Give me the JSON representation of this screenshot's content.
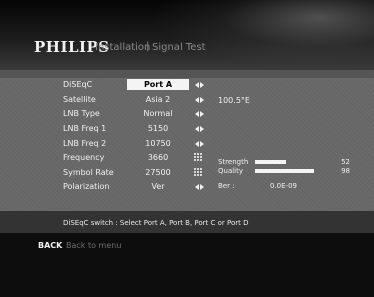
{
  "header": {
    "brand": "PHILIPS",
    "crumb": "Installation",
    "separator": "|",
    "page_title": "Signal Test"
  },
  "settings": [
    {
      "label": "DiSEqC",
      "value": "Port A",
      "control": "arrows",
      "selected": true
    },
    {
      "label": "Satellite",
      "value": "Asia 2",
      "control": "arrows",
      "selected": false
    },
    {
      "label": "LNB Type",
      "value": "Normal",
      "control": "arrows",
      "selected": false
    },
    {
      "label": "LNB Freq 1",
      "value": "5150",
      "control": "arrows",
      "selected": false
    },
    {
      "label": "LNB Freq 2",
      "value": "10750",
      "control": "arrows",
      "selected": false
    },
    {
      "label": "Frequency",
      "value": "3660",
      "control": "keypad",
      "selected": false
    },
    {
      "label": "Symbol Rate",
      "value": "27500",
      "control": "keypad",
      "selected": false
    },
    {
      "label": "Polarization",
      "value": "Ver",
      "control": "arrows",
      "selected": false
    }
  ],
  "orbital_position": "100.5°E",
  "signal": {
    "strength_label": "Strength",
    "strength_value": "52",
    "strength_level": 0.52,
    "quality_label": "Quality",
    "quality_value": "98",
    "quality_level": 0.98,
    "ber_label": "Ber :",
    "ber_value": "0.0E-09"
  },
  "hint": "DiSEqC switch : Select Port A, Port B, Port C or Port D",
  "footer": {
    "back_key": "BACK",
    "back_text": "Back to menu"
  },
  "colors": {
    "panel": "#6a6a6a",
    "highlight": "#f4f4f4",
    "text": "#f0f0f0"
  },
  "icons": {
    "arrows": "left-right-arrows-icon",
    "keypad": "numeric-keypad-icon"
  }
}
